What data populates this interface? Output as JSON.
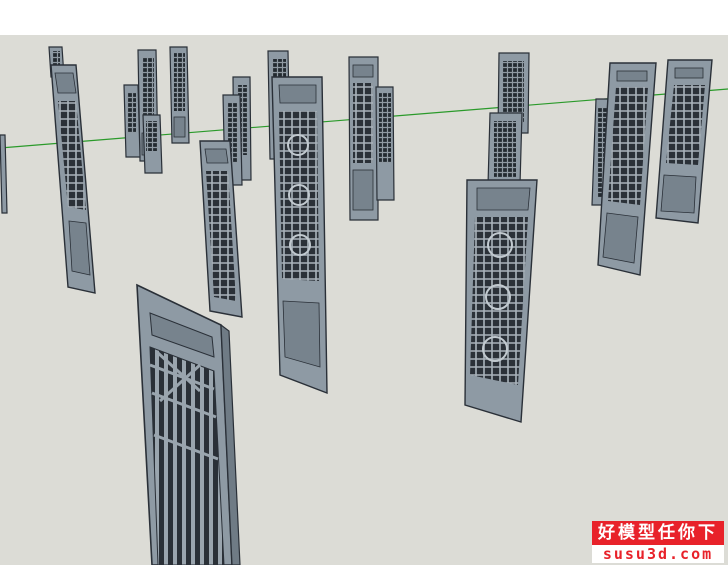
{
  "watermark": {
    "line1": "好模型任你下",
    "line2": "susu3d.com"
  },
  "colors": {
    "canvas": "#dcdcd6",
    "axis_green": "#2a9a2a",
    "panel_fill": "#8e9aa4",
    "panel_edge": "#2a3038",
    "watermark_red": "#e8222a"
  }
}
